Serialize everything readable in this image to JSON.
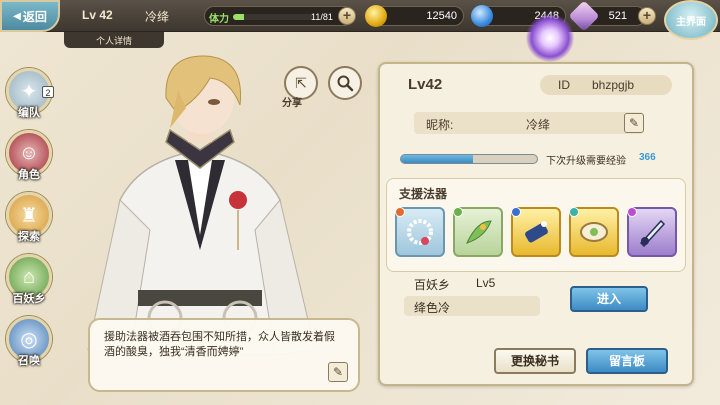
{
  "topbar": {
    "back_label": "返回",
    "level": "Lv 42",
    "player_name": "冷绛",
    "stamina_label": "体力",
    "stamina_value": "11/81",
    "stamina_fraction": 0.136,
    "coins": "12540",
    "jade": "2448",
    "crystals": "521",
    "main_menu_label": "主界面"
  },
  "subtab": {
    "label": "个人详情"
  },
  "sidebar": {
    "items": [
      {
        "label": "编队",
        "badge": "2",
        "icon": "team-icon"
      },
      {
        "label": "角色",
        "icon": "character-icon"
      },
      {
        "label": "探索",
        "icon": "explore-icon"
      },
      {
        "label": "百妖乡",
        "icon": "yokai-village-icon"
      },
      {
        "label": "召唤",
        "icon": "summon-icon"
      }
    ]
  },
  "character": {
    "share_label": "分享",
    "quote": "援助法器被酒吞包围不知所措，众人皆散发着假酒的酸臭，独我“清香而娉婷”"
  },
  "profile": {
    "level": "Lv42",
    "id_label": "ID",
    "id_value": "bhzpgjb",
    "nickname_label": "昵称:",
    "nickname_value": "冷绛",
    "exp_fraction": 0.53,
    "exp_label": "下次升级需要经验",
    "exp_value": "366",
    "support_title": "支援法器",
    "support_items": [
      {
        "icon": "bead-bracelet-icon",
        "rarity": "blue"
      },
      {
        "icon": "herb-charm-icon",
        "rarity": "green"
      },
      {
        "icon": "scroll-icon",
        "rarity": "gold"
      },
      {
        "icon": "mirror-icon",
        "rarity": "gold"
      },
      {
        "icon": "blade-icon",
        "rarity": "purple"
      }
    ],
    "yokai_label": "百妖乡",
    "yokai_level": "Lv5",
    "yokai_name": "绛色冷",
    "enter_button": "进入",
    "secretary_button": "更换秘书",
    "message_button": "留言板"
  },
  "colors": {
    "accent_blue": "#3e8bc4",
    "stamina_green": "#9ae06b",
    "exp_blue": "#3a9ad6",
    "panel_bg": "#f6f0e0"
  }
}
